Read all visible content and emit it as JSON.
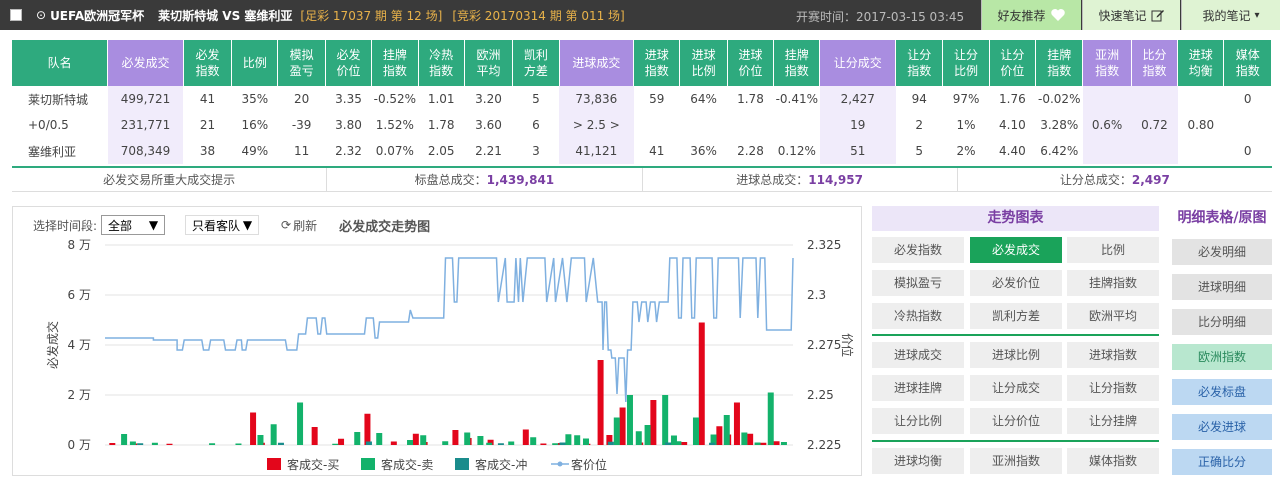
{
  "header": {
    "title": "UEFA欧洲冠军杯",
    "match": "莱切斯特城  VS 塞维利亚",
    "issue_zc": "[足彩 17037 期 第 12 场]",
    "issue_jc": "[竞彩 20170314 期 第 011 场]",
    "start_time": "开赛时间：2017-03-15 03:45",
    "btn_friend": "好友推荐",
    "btn_quick_note": "快速笔记",
    "btn_my_note": "我的笔记"
  },
  "table": {
    "headers": [
      "队名",
      "必发成交",
      "必发指数",
      "比例",
      "模拟盈亏",
      "必发价位",
      "挂牌指数",
      "冷热指数",
      "欧洲平均",
      "凯利方差",
      "进球成交",
      "进球指数",
      "进球比例",
      "进球价位",
      "挂牌指数",
      "让分成交",
      "让分指数",
      "让分比例",
      "让分价位",
      "挂牌指数",
      "亚洲指数",
      "比分指数",
      "进球均衡",
      "媒体指数"
    ],
    "rows": [
      [
        "莱切斯特城",
        "499,721",
        "41",
        "35%",
        "20",
        "3.35",
        "-0.52%",
        "1.01",
        "3.20",
        "5",
        "73,836",
        "59",
        "64%",
        "1.78",
        "-0.41%",
        "2,427",
        "94",
        "97%",
        "1.76",
        "-0.02%",
        "",
        "",
        "",
        "0"
      ],
      [
        "+0/0.5",
        "231,771",
        "21",
        "16%",
        "-39",
        "3.80",
        "1.52%",
        "1.78",
        "3.60",
        "6",
        "> 2.5 >",
        "",
        "",
        "",
        "",
        "19",
        "2",
        "1%",
        "4.10",
        "3.28%",
        "0.6%",
        "0.72",
        "0.80",
        ""
      ],
      [
        "塞维利亚",
        "708,349",
        "38",
        "49%",
        "11",
        "2.32",
        "0.07%",
        "2.05",
        "2.21",
        "3",
        "41,121",
        "41",
        "36%",
        "2.28",
        "0.12%",
        "51",
        "5",
        "2%",
        "4.40",
        "6.42%",
        "",
        "",
        "",
        "0"
      ]
    ]
  },
  "summary": {
    "hint": "必发交易所重大成交提示",
    "pan_label": "标盘总成交：",
    "pan_value": "1,439,841",
    "goal_label": "进球总成交：",
    "goal_value": "114,957",
    "handicap_label": "让分总成交：",
    "handicap_value": "2,497"
  },
  "controls": {
    "period_label": "选择时间段:",
    "period_value": "全部",
    "team_value": "只看客队",
    "refresh": "刷新",
    "chart_title": "必发成交走势图"
  },
  "chart_data": {
    "type": "bar",
    "left_axis": {
      "label": "必发成交",
      "ticks": [
        "0 万",
        "2 万",
        "4 万",
        "6 万",
        "8 万"
      ],
      "range": [
        0,
        80000
      ]
    },
    "right_axis": {
      "label": "价位",
      "ticks": [
        "2.225",
        "2.25",
        "2.275",
        "2.3",
        "2.325"
      ],
      "range": [
        2.225,
        2.325
      ]
    },
    "legend": [
      "客成交-买",
      "客成交-卖",
      "客成交-冲",
      "客价位"
    ],
    "colors": {
      "buy": "#e3061b",
      "sell": "#13b26b",
      "hedge": "#1a8c8c",
      "price": "#7fb0e0"
    },
    "buy": [
      [
        10,
        800
      ],
      [
        35,
        600
      ],
      [
        75,
        500
      ],
      [
        170,
        13000
      ],
      [
        180,
        900
      ],
      [
        240,
        7200
      ],
      [
        270,
        2500
      ],
      [
        300,
        12500
      ],
      [
        330,
        1400
      ],
      [
        355,
        4500
      ],
      [
        365,
        1200
      ],
      [
        400,
        6000
      ],
      [
        415,
        2800
      ],
      [
        440,
        2100
      ],
      [
        480,
        6200
      ],
      [
        500,
        600
      ],
      [
        520,
        800
      ],
      [
        550,
        500
      ],
      [
        565,
        34000
      ],
      [
        575,
        4000
      ],
      [
        590,
        15000
      ],
      [
        610,
        1000
      ],
      [
        625,
        18000
      ],
      [
        660,
        1200
      ],
      [
        680,
        49000
      ],
      [
        700,
        7500
      ],
      [
        710,
        4200
      ],
      [
        720,
        17000
      ],
      [
        735,
        4500
      ],
      [
        750,
        900
      ],
      [
        765,
        1500
      ]
    ],
    "sell": [
      [
        20,
        4400
      ],
      [
        30,
        1400
      ],
      [
        55,
        900
      ],
      [
        120,
        700
      ],
      [
        150,
        600
      ],
      [
        175,
        4000
      ],
      [
        190,
        8300
      ],
      [
        220,
        17000
      ],
      [
        260,
        500
      ],
      [
        285,
        5200
      ],
      [
        310,
        4800
      ],
      [
        345,
        2000
      ],
      [
        360,
        3900
      ],
      [
        385,
        1500
      ],
      [
        410,
        5000
      ],
      [
        425,
        3600
      ],
      [
        435,
        900
      ],
      [
        460,
        1400
      ],
      [
        485,
        3100
      ],
      [
        510,
        700
      ],
      [
        525,
        4300
      ],
      [
        535,
        3900
      ],
      [
        545,
        2600
      ],
      [
        580,
        11000
      ],
      [
        595,
        20000
      ],
      [
        605,
        5500
      ],
      [
        615,
        8000
      ],
      [
        635,
        20000
      ],
      [
        645,
        3800
      ],
      [
        650,
        1500
      ],
      [
        670,
        11000
      ],
      [
        690,
        4200
      ],
      [
        705,
        12000
      ],
      [
        725,
        5000
      ],
      [
        740,
        1000
      ],
      [
        755,
        21000
      ],
      [
        770,
        1200
      ]
    ],
    "hedge": [
      [
        40,
        700
      ],
      [
        200,
        900
      ],
      [
        300,
        1400
      ],
      [
        450,
        700
      ],
      [
        520,
        1000
      ],
      [
        575,
        1300
      ],
      [
        640,
        1000
      ],
      [
        690,
        900
      ]
    ],
    "price": [
      [
        0,
        2.2785
      ],
      [
        55,
        2.2785
      ],
      [
        55,
        2.2775
      ],
      [
        82,
        2.2775
      ],
      [
        82,
        2.2725
      ],
      [
        88,
        2.2725
      ],
      [
        90,
        2.2775
      ],
      [
        110,
        2.2775
      ],
      [
        112,
        2.2725
      ],
      [
        118,
        2.2725
      ],
      [
        120,
        2.2775
      ],
      [
        135,
        2.2775
      ],
      [
        137,
        2.2725
      ],
      [
        148,
        2.2725
      ],
      [
        150,
        2.2775
      ],
      [
        155,
        2.2775
      ],
      [
        156,
        2.2725
      ],
      [
        160,
        2.2725
      ],
      [
        162,
        2.2775
      ],
      [
        205,
        2.2775
      ],
      [
        207,
        2.2725
      ],
      [
        218,
        2.2725
      ],
      [
        220,
        2.2805
      ],
      [
        228,
        2.2805
      ],
      [
        230,
        2.2885
      ],
      [
        240,
        2.2885
      ],
      [
        242,
        2.2805
      ],
      [
        245,
        2.2805
      ],
      [
        247,
        2.2885
      ],
      [
        250,
        2.2885
      ],
      [
        252,
        2.2805
      ],
      [
        295,
        2.2805
      ],
      [
        297,
        2.2885
      ],
      [
        305,
        2.2885
      ],
      [
        307,
        2.2785
      ],
      [
        310,
        2.2785
      ],
      [
        312,
        2.2865
      ],
      [
        345,
        2.2865
      ],
      [
        347,
        2.2925
      ],
      [
        350,
        2.2885
      ],
      [
        385,
        2.2885
      ],
      [
        387,
        2.3185
      ],
      [
        395,
        2.3185
      ],
      [
        397,
        2.2965
      ],
      [
        400,
        2.2965
      ],
      [
        402,
        2.3185
      ],
      [
        445,
        2.3185
      ],
      [
        447,
        2.2965
      ],
      [
        455,
        2.3185
      ],
      [
        457,
        2.2965
      ],
      [
        465,
        2.2965
      ],
      [
        467,
        2.3185
      ],
      [
        470,
        2.2965
      ],
      [
        472,
        2.3185
      ],
      [
        475,
        2.2965
      ],
      [
        480,
        2.3185
      ],
      [
        500,
        2.3185
      ],
      [
        502,
        2.2965
      ],
      [
        510,
        2.3185
      ],
      [
        512,
        2.2965
      ],
      [
        520,
        2.3185
      ],
      [
        525,
        2.2965
      ],
      [
        530,
        2.3185
      ],
      [
        545,
        2.3185
      ],
      [
        547,
        2.2965
      ],
      [
        555,
        2.3185
      ],
      [
        560,
        2.2965
      ],
      [
        565,
        2.2965
      ],
      [
        566,
        2.2725
      ],
      [
        568,
        2.2965
      ],
      [
        570,
        2.2965
      ],
      [
        572,
        2.2725
      ],
      [
        575,
        2.2725
      ],
      [
        576,
        2.2685
      ],
      [
        580,
        2.2685
      ],
      [
        582,
        2.2505
      ],
      [
        584,
        2.2685
      ],
      [
        590,
        2.2685
      ],
      [
        592,
        2.2465
      ],
      [
        594,
        2.2725
      ],
      [
        598,
        2.2725
      ],
      [
        600,
        2.2965
      ],
      [
        605,
        2.2965
      ],
      [
        607,
        2.2865
      ],
      [
        610,
        2.2965
      ],
      [
        615,
        2.2965
      ],
      [
        617,
        2.2865
      ],
      [
        620,
        2.2965
      ],
      [
        625,
        2.2965
      ],
      [
        627,
        2.2865
      ],
      [
        630,
        2.2965
      ],
      [
        635,
        2.2965
      ],
      [
        640,
        2.2965
      ],
      [
        642,
        2.3185
      ],
      [
        650,
        2.3185
      ],
      [
        652,
        2.2885
      ],
      [
        655,
        2.2885
      ],
      [
        657,
        2.3185
      ],
      [
        665,
        2.3185
      ],
      [
        667,
        2.2885
      ],
      [
        670,
        2.2885
      ],
      [
        672,
        2.3185
      ],
      [
        690,
        2.3185
      ],
      [
        692,
        2.2885
      ],
      [
        695,
        2.2885
      ],
      [
        697,
        2.3185
      ],
      [
        720,
        2.3185
      ],
      [
        722,
        2.2885
      ],
      [
        725,
        2.3185
      ],
      [
        740,
        2.3185
      ],
      [
        742,
        2.2885
      ],
      [
        745,
        2.3185
      ],
      [
        750,
        2.3185
      ],
      [
        752,
        2.2825
      ],
      [
        780,
        2.2825
      ],
      [
        782,
        2.3185
      ]
    ]
  },
  "trend": {
    "title": "走势图表",
    "group1": [
      "必发指数",
      "必发成交",
      "比例",
      "模拟盈亏",
      "必发价位",
      "挂牌指数",
      "冷热指数",
      "凯利方差",
      "欧洲平均"
    ],
    "group2": [
      "进球成交",
      "进球比例",
      "进球指数",
      "进球挂牌",
      "让分成交",
      "让分指数",
      "让分比例",
      "让分价位",
      "让分挂牌"
    ],
    "group3": [
      "进球均衡",
      "亚洲指数",
      "媒体指数"
    ]
  },
  "detail": {
    "title": "明细表格/原图",
    "items": [
      "必发明细",
      "进球明细",
      "比分明细",
      "欧洲指数",
      "必发标盘",
      "必发进球",
      "正确比分"
    ]
  }
}
